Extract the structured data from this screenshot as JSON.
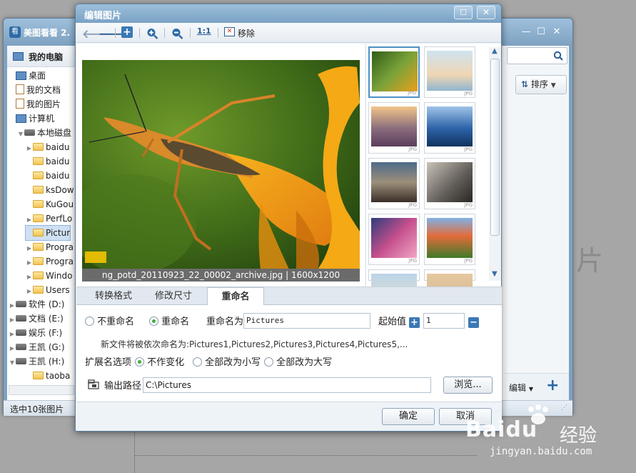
{
  "background_window": {
    "title": "美图看看 2.",
    "right_text": "片",
    "sort_label": "排序",
    "edit_label": "编辑",
    "status": "选中10张图片",
    "sidebar_header": "我的电脑",
    "tree": [
      {
        "label": "桌面",
        "icon": "desktop-icon"
      },
      {
        "label": "我的文档",
        "icon": "document-icon"
      },
      {
        "label": "我的图片",
        "icon": "document-icon"
      },
      {
        "label": "计算机",
        "icon": "computer-icon"
      },
      {
        "label": "本地磁盘",
        "icon": "drive-icon"
      },
      {
        "label": "baidu",
        "icon": "folder-icon"
      },
      {
        "label": "baidu",
        "icon": "folder-icon"
      },
      {
        "label": "baidu",
        "icon": "folder-icon"
      },
      {
        "label": "ksDow",
        "icon": "folder-icon"
      },
      {
        "label": "KuGou",
        "icon": "folder-icon"
      },
      {
        "label": "PerfLo",
        "icon": "folder-icon"
      },
      {
        "label": "Pictur",
        "icon": "folder-icon"
      },
      {
        "label": "Progra",
        "icon": "folder-icon"
      },
      {
        "label": "Progra",
        "icon": "folder-icon"
      },
      {
        "label": "Windo",
        "icon": "folder-icon"
      },
      {
        "label": "Users",
        "icon": "folder-icon"
      },
      {
        "label": "软件 (D:)",
        "icon": "drive-icon"
      },
      {
        "label": "文档 (E:)",
        "icon": "drive-icon"
      },
      {
        "label": "娱乐 (F:)",
        "icon": "drive-icon"
      },
      {
        "label": "王凯 (G:)",
        "icon": "drive-icon"
      },
      {
        "label": "王凯 (H:)",
        "icon": "drive-icon"
      },
      {
        "label": "taoba",
        "icon": "folder-icon"
      }
    ]
  },
  "dialog": {
    "title": "编辑图片",
    "toolbar": {
      "zoom_actual": "1:1",
      "remove_label": "移除"
    },
    "photo_caption": "ng_potd_20110923_22_00002_archive.jpg | 1600x1200",
    "thumb_tag": "JPG",
    "tabs": [
      "转换格式",
      "修改尺寸",
      "重命名"
    ],
    "rename": {
      "no_rename": "不重命名",
      "rename": "重命名",
      "rename_as_label": "重命名为",
      "rename_as_value": "Pictures",
      "start_label": "起始值",
      "start_value": "1",
      "preview": "新文件将被依次命名为:Pictures1,Pictures2,Pictures3,Pictures4,Pictures5,...",
      "ext_label": "扩展名选项",
      "ext_options": [
        "不作变化",
        "全部改为小写",
        "全部改为大写"
      ],
      "output_label": "输出路径",
      "output_value": "C:\\Pictures",
      "browse": "浏览..."
    },
    "ok": "确定",
    "cancel": "取消"
  },
  "watermark": {
    "brand": "Baidu",
    "sub": "经验",
    "url": "jingyan.baidu.com"
  }
}
